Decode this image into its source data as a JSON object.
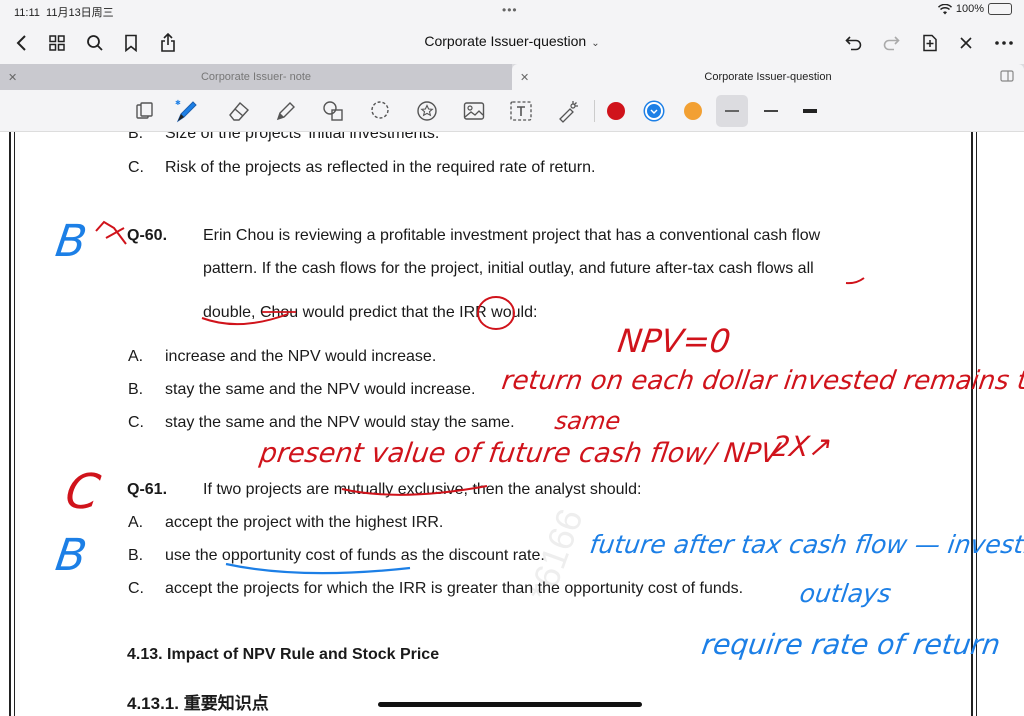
{
  "status": {
    "time": "11:11",
    "date": "11月13日周三",
    "battery": "100%",
    "battery_level": 1.0
  },
  "toolbar": {
    "title": "Corporate Issuer-question"
  },
  "tabs": [
    {
      "label": "Corporate Issuer- note",
      "active": false
    },
    {
      "label": "Corporate Issuer-question",
      "active": true
    }
  ],
  "pen_colors": [
    "#d0131b",
    "#1c7fe6",
    "#f2a033"
  ],
  "selected_color": "#1c7fe6",
  "document": {
    "option_b_top": {
      "letter": "B.",
      "text": "Size of the projects' initial investments."
    },
    "option_c_top": {
      "letter": "C.",
      "text": "Risk of the projects as reflected in the required rate of return."
    },
    "q60": {
      "number": "Q-60.",
      "line1": "Erin Chou is reviewing a profitable investment project that has a conventional cash flow",
      "line2": "pattern. If the cash flows for the project, initial outlay, and future after-tax cash flows all",
      "line3": "double, Chou would predict that the IRR would:",
      "options": [
        {
          "letter": "A.",
          "text": "increase and the NPV would increase."
        },
        {
          "letter": "B.",
          "text": "stay the same and the NPV would increase."
        },
        {
          "letter": "C.",
          "text": "stay the same and the NPV would stay the same."
        }
      ]
    },
    "q61": {
      "number": "Q-61.",
      "line1": "If two projects are mutually exclusive, then the analyst should:",
      "options": [
        {
          "letter": "A.",
          "text": "accept the project with the highest IRR."
        },
        {
          "letter": "B.",
          "text": "use the opportunity cost of funds as the discount rate."
        },
        {
          "letter": "C.",
          "text": "accept the projects for which the IRR is greater than the opportunity cost of funds."
        }
      ]
    },
    "section_413": "4.13.  Impact of NPV Rule and Stock Price",
    "section_4131": "4.13.1.  重要知识点",
    "watermark": "*6166"
  },
  "handwriting": {
    "q60_answer": "B",
    "npv_note": "NPV=0",
    "note_return": "return on each dollar invested remains the",
    "note_same": "same",
    "note_pv": "present value of future cash flow/ NPV",
    "note_2x": "2X↗",
    "q61_mark": "C",
    "q61_answer": "B",
    "note_future": "future after tax cash flow — investment",
    "note_outlays": "outlays",
    "note_required": "require rate of return"
  }
}
